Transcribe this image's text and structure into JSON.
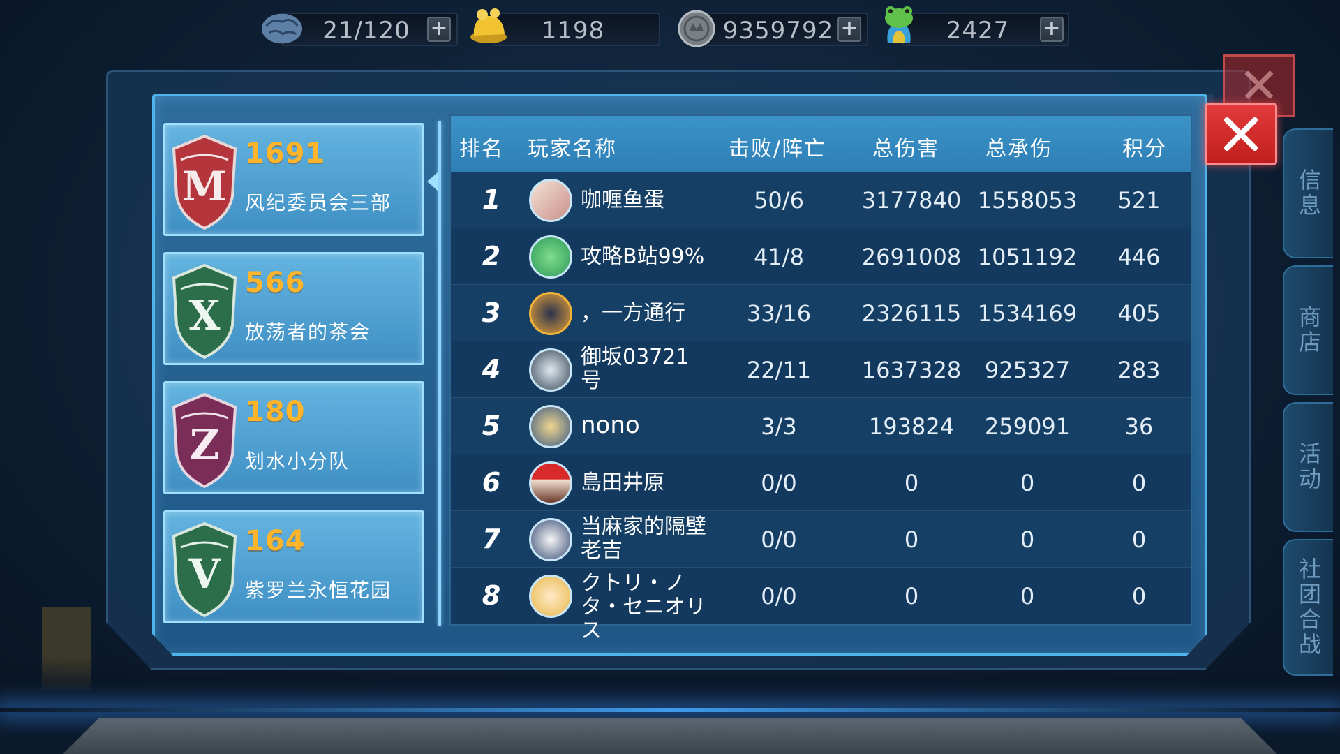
{
  "resources": [
    {
      "icon": "brain-icon",
      "value": "21/120",
      "has_plus": true
    },
    {
      "icon": "pudding-icon",
      "value": "1198",
      "has_plus": false
    },
    {
      "icon": "coin-icon",
      "value": "9359792",
      "has_plus": true
    },
    {
      "icon": "frog-icon",
      "value": "2427",
      "has_plus": true
    }
  ],
  "plus_label": "+",
  "guilds": [
    {
      "score": "1691",
      "name": "风纪委员会三部",
      "emblem_letter": "M",
      "color": "#b4353b"
    },
    {
      "score": "566",
      "name": "放荡者的茶会",
      "emblem_letter": "X",
      "color": "#2d6e4a"
    },
    {
      "score": "180",
      "name": "划水小分队",
      "emblem_letter": "Z",
      "color": "#7a2e57"
    },
    {
      "score": "164",
      "name": "紫罗兰永恒花园",
      "emblem_letter": "V",
      "color": "#2d6e4a"
    }
  ],
  "table": {
    "headers": {
      "rank": "排名",
      "player": "玩家名称",
      "kd": "击败/阵亡",
      "damage": "总伤害",
      "taken": "总承伤",
      "points": "积分"
    },
    "rows": [
      {
        "rank": "1",
        "name": "咖喱鱼蛋",
        "kd": "50/6",
        "damage": "3177840",
        "taken": "1558053",
        "points": "521"
      },
      {
        "rank": "2",
        "name": "攻略B站99%",
        "kd": "41/8",
        "damage": "2691008",
        "taken": "1051192",
        "points": "446"
      },
      {
        "rank": "3",
        "name": "，一方通行",
        "kd": "33/16",
        "damage": "2326115",
        "taken": "1534169",
        "points": "405"
      },
      {
        "rank": "4",
        "name": "御坂03721号",
        "kd": "22/11",
        "damage": "1637328",
        "taken": "925327",
        "points": "283"
      },
      {
        "rank": "5",
        "name": "nono",
        "kd": "3/3",
        "damage": "193824",
        "taken": "259091",
        "points": "36"
      },
      {
        "rank": "6",
        "name": "島田井原",
        "kd": "0/0",
        "damage": "0",
        "taken": "0",
        "points": "0"
      },
      {
        "rank": "7",
        "name": "当麻家的隔壁老吉",
        "kd": "0/0",
        "damage": "0",
        "taken": "0",
        "points": "0"
      },
      {
        "rank": "8",
        "name": "クトリ・ノタ・セニオリス",
        "kd": "0/0",
        "damage": "0",
        "taken": "0",
        "points": "0"
      }
    ]
  },
  "side_menu": [
    "信息",
    "商店",
    "活动",
    "社团合战"
  ],
  "colors": {
    "score": "#ffb42a",
    "close": "#d42b2b",
    "accent": "#4fb4ec"
  }
}
